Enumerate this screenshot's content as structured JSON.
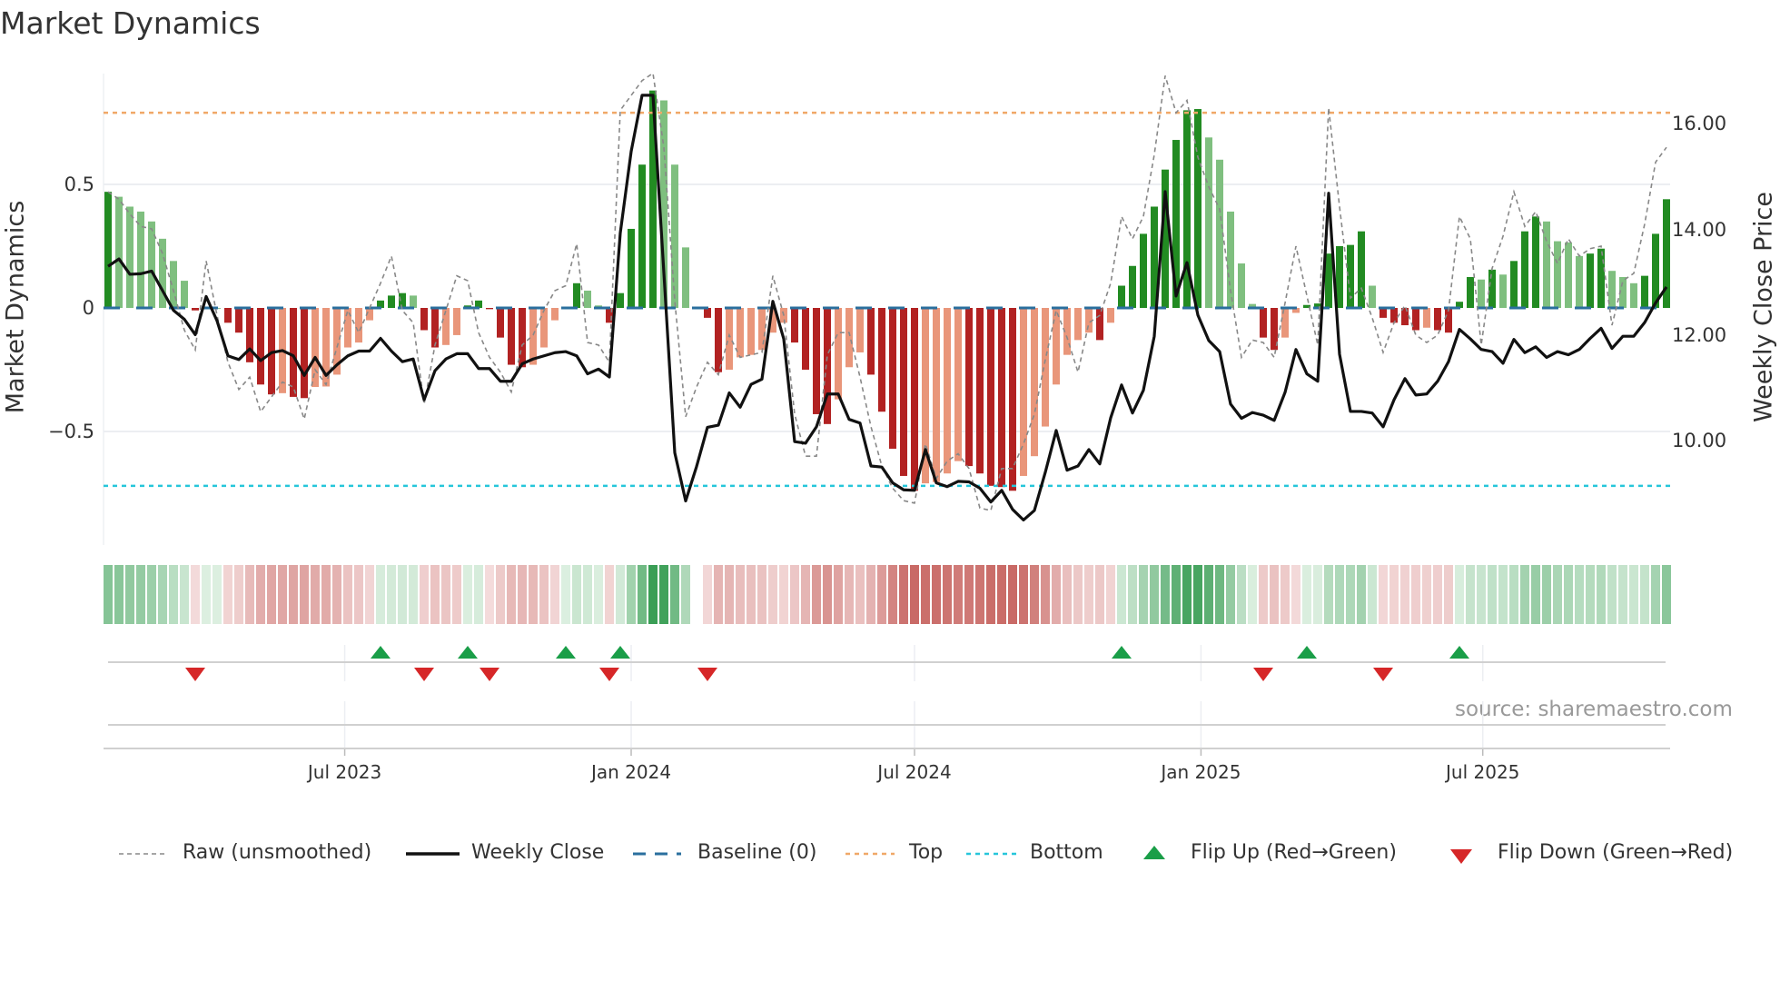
{
  "chart_data": {
    "type": "bar",
    "title": "Market Dynamics",
    "ylabel": "Market Dynamics",
    "y2label": "Weekly Close Price",
    "ylim": [
      -0.96,
      0.95
    ],
    "y2lim": [
      8.04,
      16.94
    ],
    "start_date": "2023-01-30",
    "interval": "weekly",
    "left_ticks": [
      {
        "v": 0.5,
        "label": "0.5"
      },
      {
        "v": 0,
        "label": "0"
      },
      {
        "v": -0.5,
        "label": "−0.5"
      }
    ],
    "right_ticks": [
      {
        "v": 16,
        "label": "16.00"
      },
      {
        "v": 14,
        "label": "14.00"
      },
      {
        "v": 12,
        "label": "12.00"
      },
      {
        "v": 10,
        "label": "10.00"
      }
    ],
    "x_ticks": [
      {
        "date": "2023-07-01",
        "label": "Jul 2023"
      },
      {
        "date": "2024-01-01",
        "label": "Jan 2024"
      },
      {
        "date": "2024-07-01",
        "label": "Jul 2024"
      },
      {
        "date": "2025-01-01",
        "label": "Jan 2025"
      },
      {
        "date": "2025-07-01",
        "label": "Jul 2025"
      }
    ],
    "top_level": 0.79,
    "bottom_level": -0.72,
    "baseline": 0,
    "momentum": [
      0.47,
      0.45,
      0.41,
      0.39,
      0.35,
      0.28,
      0.19,
      0.11,
      -0.01,
      0,
      0,
      -0.06,
      -0.1,
      -0.22,
      -0.31,
      -0.35,
      -0.345,
      -0.36,
      -0.365,
      -0.32,
      -0.318,
      -0.27,
      -0.16,
      -0.14,
      -0.05,
      0.03,
      0.05,
      0.06,
      0.05,
      -0.09,
      -0.16,
      -0.15,
      -0.11,
      0.01,
      0.03,
      -0.005,
      -0.12,
      -0.23,
      -0.24,
      -0.23,
      -0.16,
      -0.05,
      0.003,
      0.1,
      0.07,
      0.01,
      -0.06,
      0.06,
      0.32,
      0.58,
      0.88,
      0.84,
      0.58,
      0.245,
      null,
      -0.04,
      -0.26,
      -0.25,
      -0.2,
      -0.19,
      -0.17,
      -0.1,
      -0.06,
      -0.14,
      -0.25,
      -0.43,
      -0.47,
      -0.37,
      -0.24,
      -0.18,
      -0.27,
      -0.42,
      -0.57,
      -0.68,
      -0.74,
      -0.71,
      -0.705,
      -0.67,
      -0.62,
      -0.64,
      -0.67,
      -0.72,
      -0.725,
      -0.74,
      -0.68,
      -0.6,
      -0.48,
      -0.31,
      -0.19,
      -0.13,
      -0.1,
      -0.13,
      -0.06,
      0.09,
      0.17,
      0.3,
      0.41,
      0.56,
      0.68,
      0.8,
      0.805,
      0.69,
      0.6,
      0.39,
      0.18,
      0.016,
      -0.12,
      -0.17,
      -0.12,
      -0.02,
      0.012,
      0.018,
      0.22,
      0.25,
      0.255,
      0.31,
      0.09,
      -0.04,
      -0.06,
      -0.07,
      -0.09,
      -0.08,
      -0.09,
      -0.1,
      0.025,
      0.125,
      0.115,
      0.155,
      0.135,
      0.19,
      0.31,
      0.37,
      0.35,
      0.27,
      0.265,
      0.21,
      0.22,
      0.24,
      0.15,
      0.125,
      0.1,
      0.13,
      0.3,
      0.44
    ],
    "raw": [
      0.47,
      0.44,
      0.38,
      0.33,
      0.32,
      0.22,
      0.07,
      -0.09,
      -0.17,
      0.19,
      -0.03,
      -0.22,
      -0.33,
      -0.28,
      -0.42,
      -0.36,
      -0.3,
      -0.32,
      -0.45,
      -0.25,
      -0.31,
      -0.16,
      -0.01,
      -0.1,
      0.0,
      0.1,
      0.21,
      -0.01,
      -0.06,
      -0.39,
      -0.15,
      -0.01,
      0.13,
      0.11,
      -0.1,
      -0.2,
      -0.26,
      -0.34,
      -0.15,
      -0.11,
      -0.01,
      0.07,
      0.09,
      0.26,
      -0.14,
      -0.15,
      -0.22,
      0.8,
      0.86,
      0.92,
      0.95,
      0.65,
      0.03,
      -0.44,
      -0.32,
      -0.22,
      -0.27,
      -0.11,
      -0.2,
      -0.19,
      -0.18,
      0.13,
      -0.03,
      -0.43,
      -0.6,
      -0.6,
      -0.19,
      -0.1,
      -0.1,
      -0.28,
      -0.48,
      -0.64,
      -0.73,
      -0.78,
      -0.79,
      -0.55,
      -0.69,
      -0.62,
      -0.59,
      -0.65,
      -0.81,
      -0.82,
      -0.65,
      -0.65,
      -0.55,
      -0.43,
      -0.21,
      -0.01,
      -0.12,
      -0.26,
      -0.06,
      -0.03,
      0.1,
      0.37,
      0.28,
      0.37,
      0.62,
      0.94,
      0.79,
      0.84,
      0.61,
      0.49,
      0.4,
      0.07,
      -0.2,
      -0.13,
      -0.14,
      -0.2,
      0.02,
      0.25,
      0.05,
      -0.15,
      0.81,
      0.41,
      0.04,
      0.08,
      -0.04,
      -0.18,
      -0.06,
      0.01,
      -0.11,
      -0.14,
      -0.11,
      -0.01,
      0.37,
      0.28,
      -0.15,
      0.16,
      0.29,
      0.47,
      0.33,
      0.39,
      0.27,
      0.18,
      0.28,
      0.21,
      0.24,
      0.25,
      -0.07,
      0.11,
      0.14,
      0.34,
      0.59,
      0.65
    ],
    "weekly_close": [
      13.3,
      13.44,
      13.15,
      13.16,
      13.21,
      12.84,
      12.47,
      12.3,
      12.01,
      12.73,
      12.27,
      11.61,
      11.54,
      11.74,
      11.52,
      11.67,
      11.71,
      11.61,
      11.24,
      11.58,
      11.24,
      11.44,
      11.61,
      11.7,
      11.7,
      11.94,
      11.7,
      11.5,
      11.55,
      10.78,
      11.33,
      11.55,
      11.65,
      11.65,
      11.37,
      11.37,
      11.13,
      11.13,
      11.46,
      11.55,
      11.61,
      11.67,
      11.69,
      11.61,
      11.27,
      11.36,
      11.21,
      13.93,
      15.47,
      16.53,
      16.53,
      13.18,
      9.78,
      8.87,
      9.52,
      10.26,
      10.3,
      10.91,
      10.64,
      11.07,
      11.17,
      12.64,
      11.93,
      9.99,
      9.96,
      10.27,
      10.89,
      10.89,
      10.41,
      10.34,
      9.53,
      9.51,
      9.21,
      9.08,
      9.07,
      9.84,
      9.21,
      9.14,
      9.24,
      9.23,
      9.11,
      8.85,
      9.07,
      8.71,
      8.51,
      8.69,
      9.41,
      10.2,
      9.45,
      9.53,
      9.84,
      9.57,
      10.44,
      11.06,
      10.53,
      10.96,
      11.98,
      14.71,
      12.74,
      13.37,
      12.38,
      11.9,
      11.69,
      10.7,
      10.43,
      10.54,
      10.49,
      10.39,
      10.92,
      11.73,
      11.27,
      11.13,
      14.68,
      11.64,
      10.56,
      10.56,
      10.53,
      10.27,
      10.78,
      11.18,
      10.87,
      10.89,
      11.13,
      11.5,
      12.11,
      11.93,
      11.73,
      11.69,
      11.47,
      11.92,
      11.67,
      11.78,
      11.58,
      11.69,
      11.63,
      11.73,
      11.94,
      12.13,
      11.75,
      11.98,
      11.98,
      12.24,
      12.61,
      12.91
    ],
    "flip_up": [
      "2023-07-24",
      "2023-09-18",
      "2023-11-20",
      "2023-12-25",
      "2024-11-11",
      "2025-03-10",
      "2025-06-16"
    ],
    "flip_down": [
      "2023-03-27",
      "2023-08-21",
      "2023-10-02",
      "2023-12-18",
      "2024-02-19",
      "2025-02-10",
      "2025-04-28"
    ],
    "legend": {
      "placement": "bottom",
      "items": [
        {
          "key": "raw",
          "label": "Raw (unsmoothed)"
        },
        {
          "key": "close",
          "label": "Weekly Close"
        },
        {
          "key": "baseline",
          "label": "Baseline (0)"
        },
        {
          "key": "top",
          "label": "Top"
        },
        {
          "key": "bottom",
          "label": "Bottom"
        },
        {
          "key": "up",
          "label": "Flip Up (Red→Green)"
        },
        {
          "key": "down",
          "label": "Flip Down (Green→Red)"
        }
      ]
    },
    "source": "source: sharemaestro.com"
  },
  "colors": {
    "pos_rising": "#228b22",
    "pos_falling": "#7fbf7f",
    "neg_falling": "#b22222",
    "neg_rising": "#e9967a",
    "close": "#111111",
    "raw": "#888888",
    "baseline": "#2a6f9e",
    "top": "#f0a868",
    "bottom": "#26c6da",
    "flip_up": "#1a9e48",
    "flip_down": "#d62728"
  }
}
